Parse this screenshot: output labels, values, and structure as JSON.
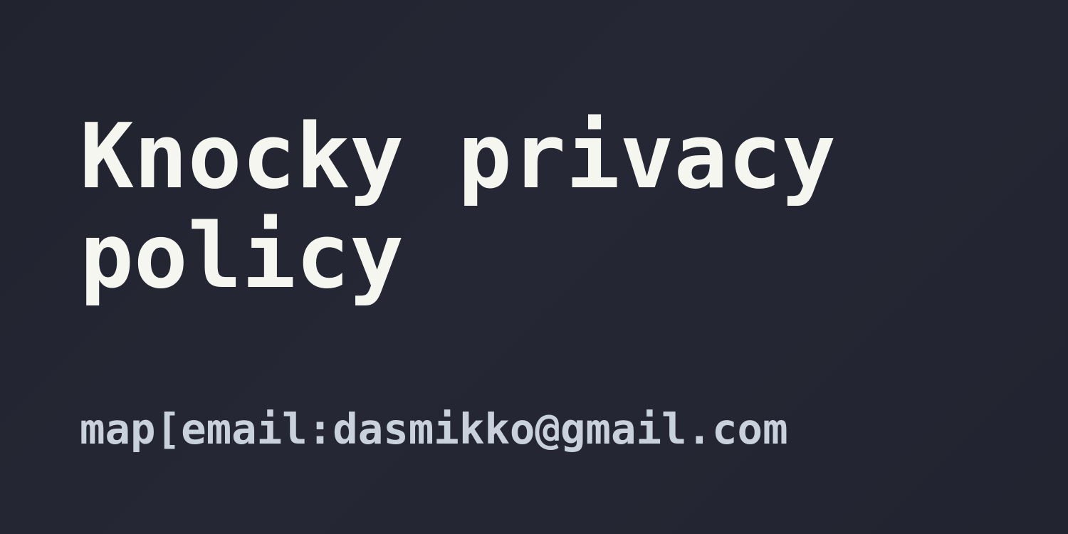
{
  "title": "Knocky privacy policy",
  "subtitle": "map[email:dasmikko@gmail.com",
  "colors": {
    "background": "#232532",
    "title": "#f6f6f0",
    "subtitle": "#c9d1dc"
  }
}
